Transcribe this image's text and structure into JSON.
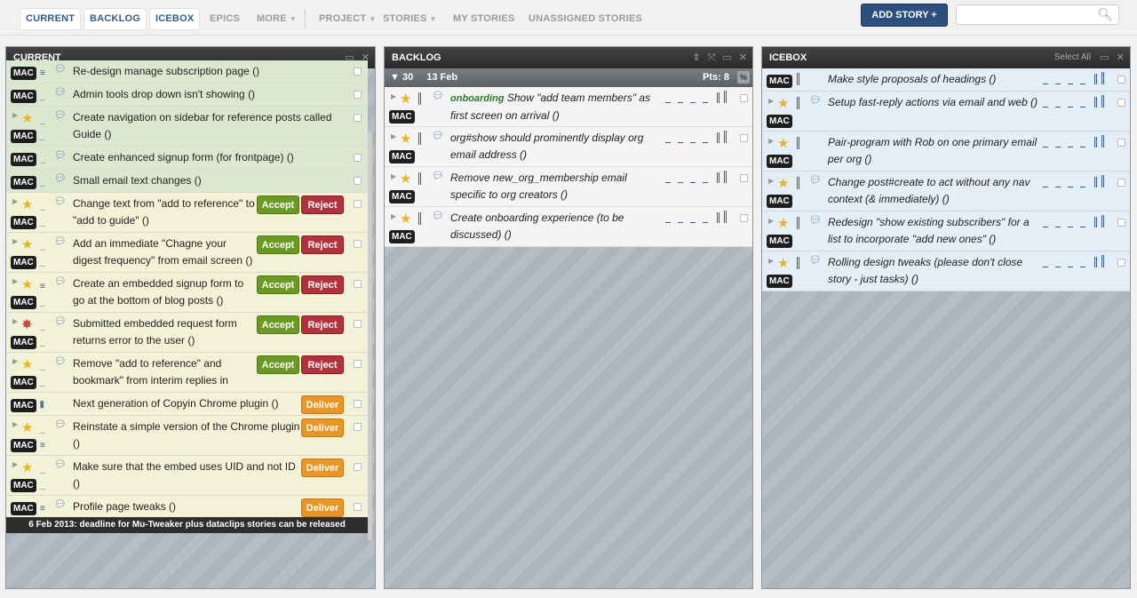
{
  "nav": {
    "tabs": [
      {
        "label": "CURRENT",
        "active": true
      },
      {
        "label": "BACKLOG",
        "active": true
      },
      {
        "label": "ICEBOX",
        "active": true
      },
      {
        "label": "EPICS",
        "active": false
      },
      {
        "label": "MORE",
        "active": false
      },
      {
        "label": "PROJECT",
        "active": false
      },
      {
        "label": "STORIES",
        "active": false
      },
      {
        "label": "MY STORIES",
        "active": false
      },
      {
        "label": "UNASSIGNED STORIES",
        "active": false
      }
    ],
    "add_story": "ADD STORY",
    "search_placeholder": ""
  },
  "panels": {
    "current": {
      "title": "CURRENT",
      "deadline": "6 Feb 2013: deadline for Mu-Tweaker plus dataclips stories can be released",
      "stories": [
        {
          "title": "Re-design manage subscription page ()",
          "tag": "MAC",
          "button": "",
          "state": "done"
        },
        {
          "title": "Admin tools drop down isn't showing ()",
          "tag": "MAC",
          "button": "",
          "state": "done"
        },
        {
          "title": "Create navigation on sidebar for reference posts called Guide ()",
          "tag": "MAC",
          "button": "",
          "state": "done"
        },
        {
          "title": "Create enhanced signup form (for frontpage) ()",
          "tag": "MAC",
          "button": "",
          "state": "done"
        },
        {
          "title": "Small email text changes ()",
          "tag": "MAC",
          "button": "",
          "state": "done"
        },
        {
          "title": "Change text from \"add to reference\" to \"add to guide\" ()",
          "tag": "MAC",
          "button": "accept-reject",
          "state": "cur"
        },
        {
          "title": "Add an immediate \"Chagne your digest frequency\" from email screen ()",
          "tag": "MAC",
          "button": "accept-reject",
          "state": "cur"
        },
        {
          "title": "Create an embedded signup form to go at the bottom of blog posts ()",
          "tag": "MAC",
          "button": "accept-reject",
          "state": "cur"
        },
        {
          "title": "Submitted embedded request form returns error to the user ()",
          "tag": "MAC",
          "button": "accept-reject",
          "state": "cur"
        },
        {
          "title": "Remove \"add to reference\" and bookmark\" from interim replies in emails ()",
          "tag": "MAC",
          "button": "accept-reject",
          "state": "cur"
        },
        {
          "title": "Next generation of Copyin Chrome plugin ()",
          "tag": "MAC",
          "button": "deliver",
          "state": "cur"
        },
        {
          "title": "Reinstate a simple version of the Chrome plugin ()",
          "tag": "MAC",
          "button": "deliver",
          "state": "cur"
        },
        {
          "title": "Make sure that the embed uses UID and not ID ()",
          "tag": "MAC",
          "button": "deliver",
          "state": "cur"
        },
        {
          "title": "Profile page tweaks ()",
          "tag": "MAC",
          "button": "deliver",
          "state": "cur"
        }
      ]
    },
    "backlog": {
      "title": "BACKLOG",
      "iteration": {
        "number": "30",
        "date": "13 Feb",
        "points": "Pts: 8",
        "pct": "%"
      },
      "stories": [
        {
          "label": "onboarding",
          "title": "Show \"add team members\" as first screen on arrival ()",
          "tag": "MAC"
        },
        {
          "label": "",
          "title": "org#show should prominently display org email address ()",
          "tag": "MAC"
        },
        {
          "label": "",
          "title": "Remove new_org_membership email specific to org creators ()",
          "tag": "MAC"
        },
        {
          "label": "",
          "title": "Create onboarding experience (to be discussed) ()",
          "tag": "MAC"
        }
      ]
    },
    "icebox": {
      "title": "ICEBOX",
      "select_all": "Select All",
      "stories": [
        {
          "title": "Make style proposals of headings ()",
          "tag": "MAC"
        },
        {
          "title": "Setup fast-reply actions via email and web ()",
          "tag": "MAC"
        },
        {
          "title": "Pair-program with Rob on one primary email per org ()",
          "tag": "MAC"
        },
        {
          "title": "Change post#create to act without any nav context (& immediately) ()",
          "tag": "MAC"
        },
        {
          "title": "Redesign \"show existing subscribers\" for a list to incorporate \"add new ones\" ()",
          "tag": "MAC"
        },
        {
          "title": "Rolling design tweaks (please don't close story - just tasks) ()",
          "tag": "MAC"
        }
      ]
    }
  },
  "buttons": {
    "accept": "Accept",
    "reject": "Reject",
    "deliver": "Deliver"
  },
  "colors": {
    "accept": "#6a9a1f",
    "reject": "#b3313a",
    "deliver": "#eb9622",
    "add_story": "#2c4f7d"
  }
}
